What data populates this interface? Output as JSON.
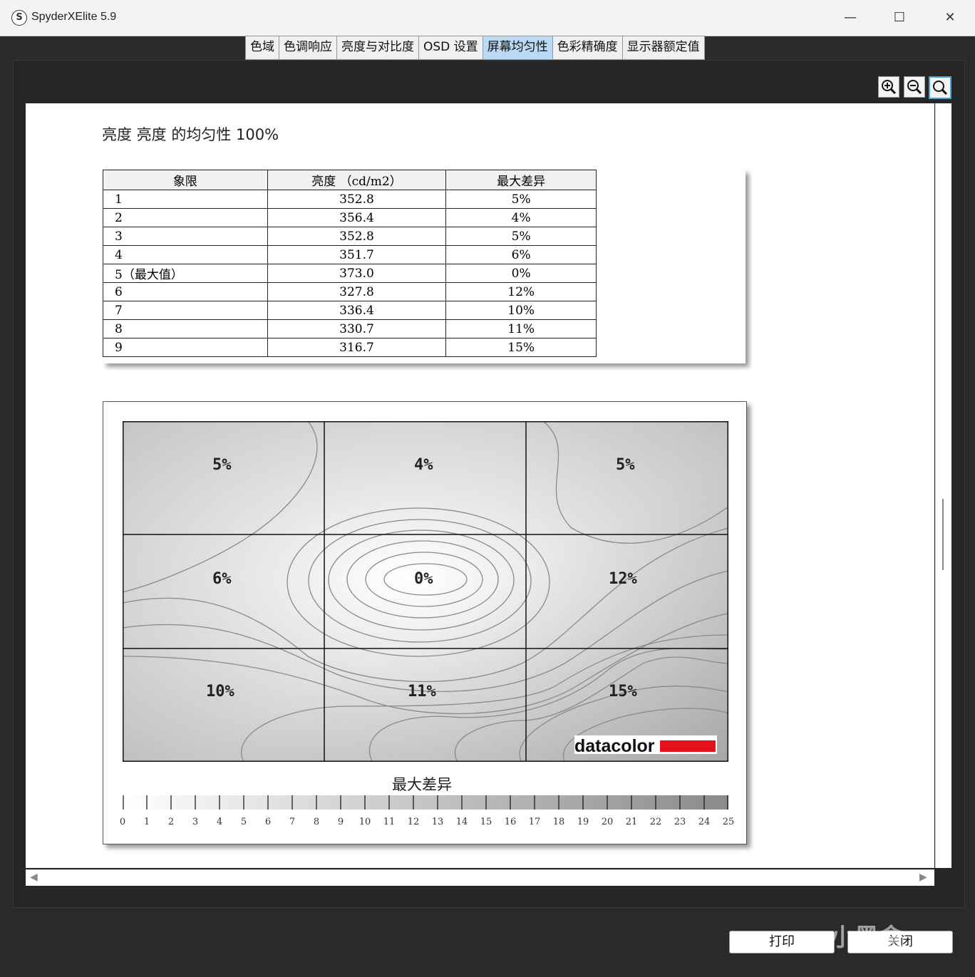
{
  "window": {
    "title": "SpyderXElite 5.9",
    "minimize": "—",
    "maximize": "☐",
    "close": "✕"
  },
  "tabs": [
    "色域",
    "色调响应",
    "亮度与对比度",
    "OSD 设置",
    "屏幕均匀性",
    "色彩精确度",
    "显示器额定值"
  ],
  "active_tab": "屏幕均匀性",
  "zoom_buttons": [
    "zoom-in-icon",
    "zoom-out-icon",
    "zoom-fit-icon"
  ],
  "report": {
    "title": "亮度 亮度 的均匀性 100%",
    "table": {
      "headers": [
        "象限",
        "亮度 （cd/m2）",
        "最大差异"
      ],
      "rows": [
        [
          "1",
          "352.8",
          "5%"
        ],
        [
          "2",
          "356.4",
          "4%"
        ],
        [
          "3",
          "352.8",
          "5%"
        ],
        [
          "4",
          "351.7",
          "6%"
        ],
        [
          "5（最大值）",
          "373.0",
          "0%"
        ],
        [
          "6",
          "327.8",
          "12%"
        ],
        [
          "7",
          "336.4",
          "10%"
        ],
        [
          "8",
          "330.7",
          "11%"
        ],
        [
          "9",
          "316.7",
          "15%"
        ]
      ]
    },
    "map": {
      "cells": [
        "5%",
        "4%",
        "5%",
        "6%",
        "0%",
        "12%",
        "10%",
        "11%",
        "15%"
      ],
      "brand": "datacolor",
      "brand_color": "#e3121b"
    },
    "legend": {
      "title": "最大差异",
      "ticks": [
        "0",
        "1",
        "2",
        "3",
        "4",
        "5",
        "6",
        "7",
        "8",
        "9",
        "10",
        "11",
        "12",
        "13",
        "14",
        "15",
        "16",
        "17",
        "18",
        "19",
        "20",
        "21",
        "22",
        "23",
        "24",
        "25"
      ]
    }
  },
  "buttons": {
    "print": "打印",
    "close": "关闭"
  },
  "watermark": "小黑盒"
}
